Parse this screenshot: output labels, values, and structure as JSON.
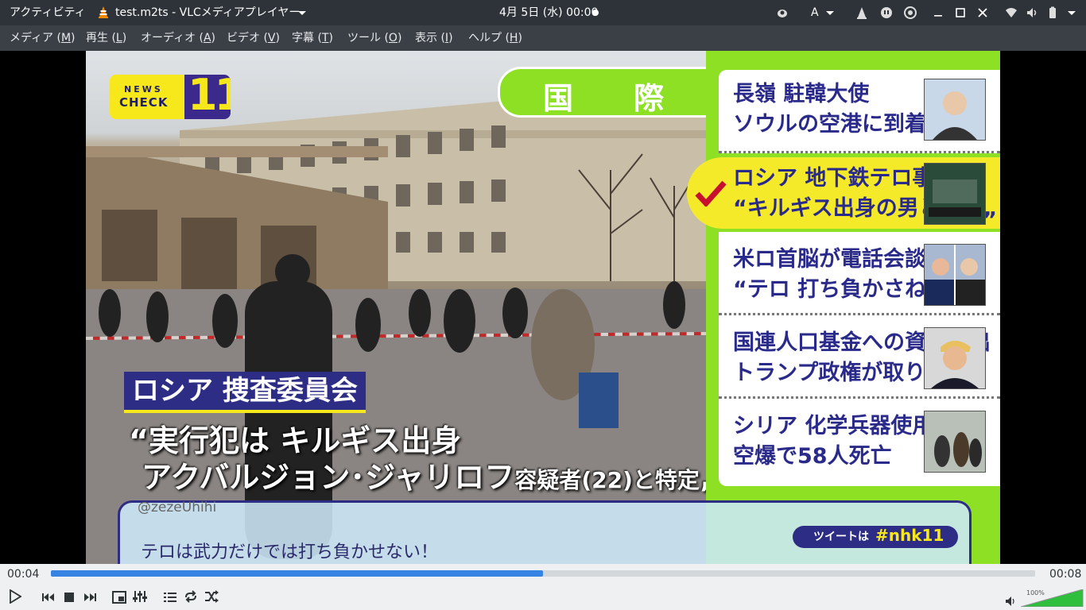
{
  "topbar": {
    "activities": "アクティビティ",
    "app_title": "test.m2ts - VLCメディアプレイヤー",
    "clock": "4月 5日 (水) 00:00",
    "input_method": "A"
  },
  "menubar": {
    "items": [
      {
        "label": "メディア",
        "mnemonic": "M"
      },
      {
        "label": "再生",
        "mnemonic": "L"
      },
      {
        "label": "オーディオ",
        "mnemonic": "A"
      },
      {
        "label": "ビデオ",
        "mnemonic": "V"
      },
      {
        "label": "字幕",
        "mnemonic": "T"
      },
      {
        "label": "ツール",
        "mnemonic": "O"
      },
      {
        "label": "表示",
        "mnemonic": "I"
      },
      {
        "label": "ヘルプ",
        "mnemonic": "H"
      }
    ]
  },
  "video": {
    "logo": {
      "line1": "NEWS",
      "line2": "CHECK",
      "number": "11"
    },
    "section_label": "国　　際",
    "caption": {
      "label": "ロシア 捜査委員会",
      "quote_open": "“",
      "line1": "実行犯は キルギス出身",
      "line2_main": "アクバルジョン･ジャリロフ",
      "line2_small": "容疑者(22)と特定",
      "quote_close": "„"
    },
    "tweet": {
      "handle": "@zezeUhihi",
      "text": "テロは武力だけでは打ち負かせない！",
      "badge_label": "ツイートは",
      "badge_tag": "#nhk11"
    },
    "news_items": [
      {
        "line1": "長嶺 駐韓大使",
        "line2": "ソウルの空港に到着"
      },
      {
        "line1": "ロシア 地下鉄テロ事件",
        "line2": "“キルギス出身の男と特定„"
      },
      {
        "line1": "米ロ首脳が電話会談",
        "line2": "“テロ 打ち負かさねば„"
      },
      {
        "line1": "国連人口基金への資金拠出",
        "line2": "トランプ政権が取りやめ"
      },
      {
        "line1": "シリア 化学兵器使用か",
        "line2": "空爆で58人死亡"
      }
    ],
    "active_item": 1,
    "colors": {
      "green_panel": "#8de024",
      "highlight": "#f5ea2a",
      "navy": "#2a2a8a"
    }
  },
  "player": {
    "elapsed": "00:04",
    "total": "00:08",
    "progress": 0.5,
    "volume_label": "100%",
    "volume": 1.0,
    "accent": "#3584e4"
  }
}
